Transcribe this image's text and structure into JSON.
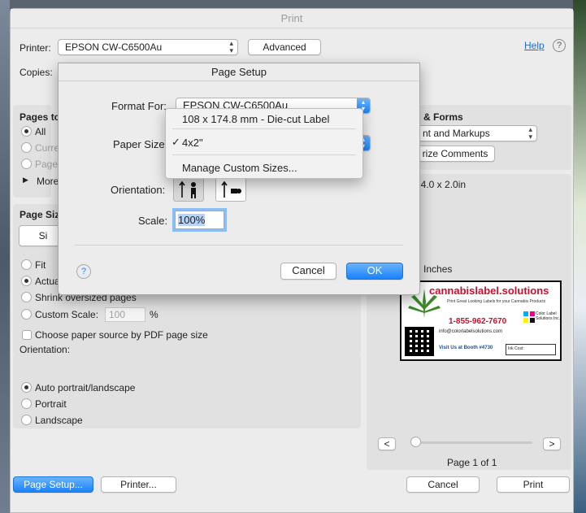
{
  "window": {
    "title": "Print"
  },
  "printer": {
    "label": "Printer:",
    "value": "EPSON CW-C6500Au",
    "advanced_button": "Advanced",
    "help_link": "Help",
    "help_icon": "?"
  },
  "copies": {
    "label": "Copies:"
  },
  "pages": {
    "header": "Pages to",
    "options": [
      "All",
      "Curre",
      "Pages"
    ],
    "more_label": "More"
  },
  "page_size": {
    "header": "Page Siz",
    "size_button": "Si",
    "options": [
      "Fit",
      "Actua",
      "Shrink oversized pages",
      "Custom Scale:"
    ],
    "custom_scale_value": "100",
    "percent_sign": "%",
    "choose_paper_label": "Choose paper source by PDF page size"
  },
  "orientation": {
    "header": "Orientation:",
    "options": [
      "Auto portrait/landscape",
      "Portrait",
      "Landscape"
    ]
  },
  "comments": {
    "header": "s & Forms",
    "dropdown_value": "nt and Markups",
    "summarize_button": "rize Comments"
  },
  "preview": {
    "size_text": ": 4.0 x 2.0in",
    "inches_text": "2 Inches",
    "page_indicator": "Page 1 of 1",
    "prev": "<",
    "next": ">"
  },
  "label_card": {
    "brand": "cannabislabel.solutions",
    "tagline": "Print Great Looking Labels for your Cannabis Products",
    "phone": "1-855-962-7670",
    "email": "info@colorlabelsolutions.com",
    "booth": "Visit Us at Booth #4730",
    "ink_cost": "Ink Cost:",
    "company": "Color Label Solutions Inc."
  },
  "footer": {
    "page_setup": "Page Setup...",
    "printer": "Printer...",
    "cancel": "Cancel",
    "print": "Print"
  },
  "page_setup_dialog": {
    "title": "Page Setup",
    "format_for_label": "Format For:",
    "format_for_value": "EPSON CW-C6500Au",
    "paper_size_label": "Paper Size",
    "orientation_label": "Orientation:",
    "scale_label": "Scale:",
    "scale_value": "100%",
    "help_icon": "?",
    "cancel": "Cancel",
    "ok": "OK"
  },
  "paper_menu": {
    "items": [
      "108 x 174.8 mm - Die-cut Label",
      "4x2\"",
      "Manage Custom Sizes..."
    ],
    "checkmark": "✓"
  },
  "colors": {
    "accent": "#1a82fb",
    "brand_red": "#c8102e",
    "leaf_green": "#3f8a2a"
  }
}
